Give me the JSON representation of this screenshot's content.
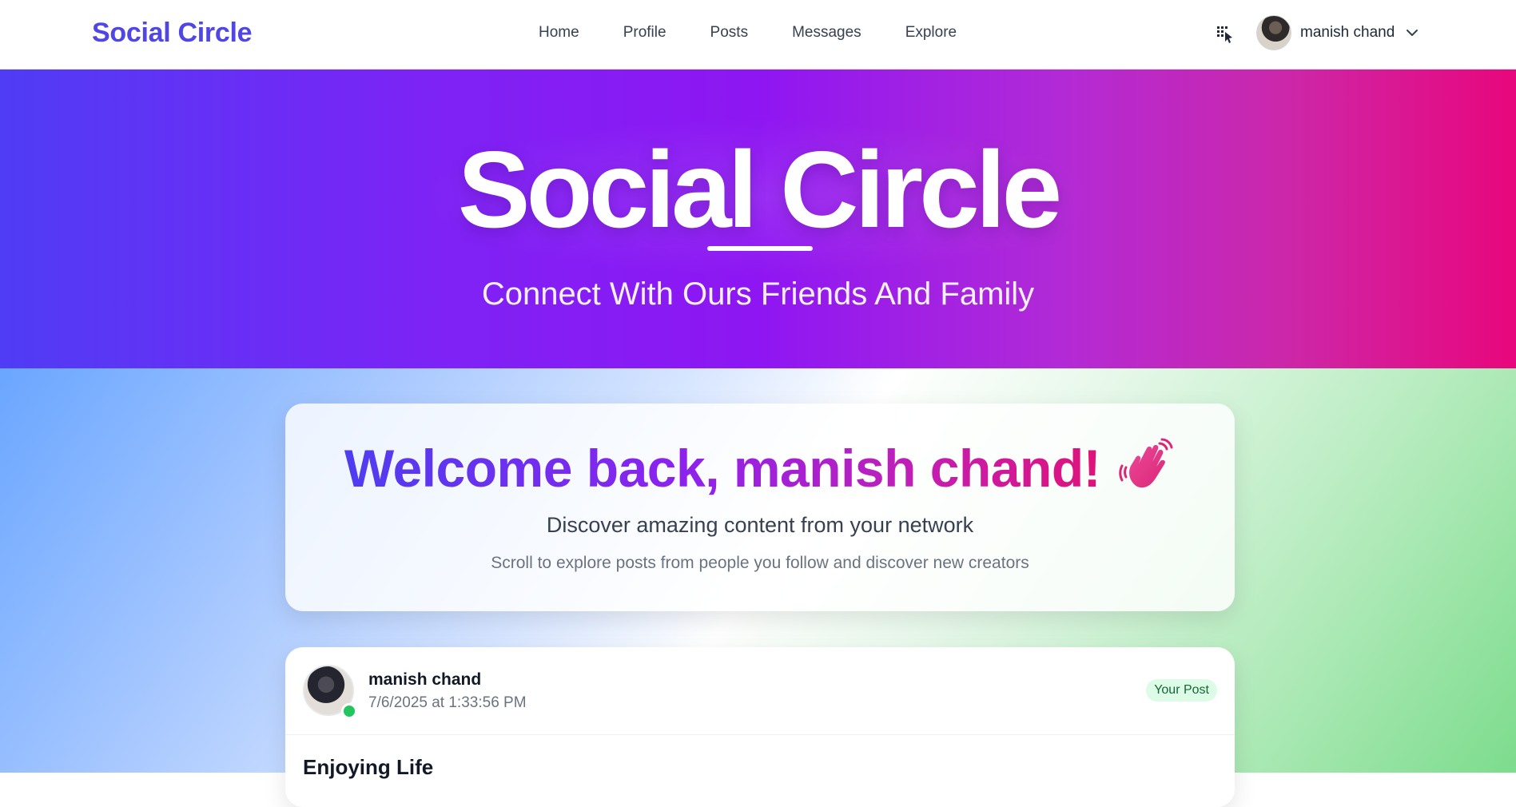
{
  "navbar": {
    "brand": "Social Circle",
    "links": [
      "Home",
      "Profile",
      "Posts",
      "Messages",
      "Explore"
    ],
    "user_name": "manish chand"
  },
  "hero": {
    "title": "Social Circle",
    "subtitle": "Connect With Ours Friends And Family"
  },
  "welcome": {
    "title": "Welcome back, manish chand!",
    "subtitle": "Discover amazing content from your network",
    "hint": "Scroll to explore posts from people you follow and discover new creators"
  },
  "post": {
    "author": "manish chand",
    "timestamp": "7/6/2025 at 1:33:56 PM",
    "badge": "Your Post",
    "title": "Enjoying Life"
  },
  "colors": {
    "brand": "#4f46e5",
    "online": "#22c55e",
    "badge_bg": "#dcfce7",
    "badge_text": "#166534"
  },
  "icons": [
    "extension-icon",
    "chevron-down-icon",
    "waving-hand-icon"
  ]
}
